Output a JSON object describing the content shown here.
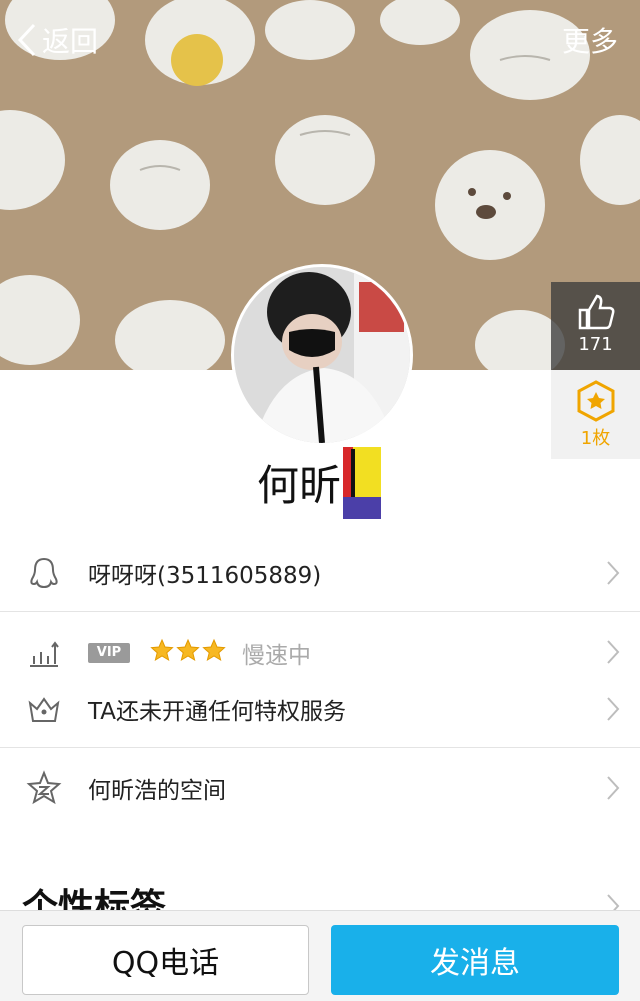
{
  "header": {
    "back_label": "返回",
    "more_label": "更多"
  },
  "side": {
    "like_count": "171",
    "badge_count": "1枚"
  },
  "profile": {
    "name": "何昕"
  },
  "rows": {
    "qq": "呀呀呀(3511605889)",
    "vip_badge": "VIP",
    "vip_status": "慢速中",
    "privilege": "TA还未开通任何特权服务",
    "space": "何昕浩的空间"
  },
  "section": {
    "tags_title": "个性标签"
  },
  "actions": {
    "call_label": "QQ电话",
    "message_label": "发消息"
  },
  "colors": {
    "cover_bg": "#b29a7c",
    "accent_blue": "#19b0ea",
    "badge_gold": "#f0a500"
  }
}
